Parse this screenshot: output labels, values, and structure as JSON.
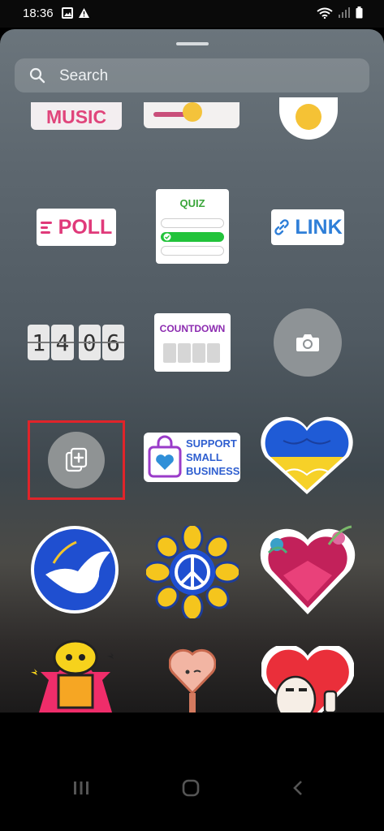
{
  "status_bar": {
    "time": "18:36"
  },
  "search": {
    "placeholder": "Search"
  },
  "stickers": {
    "music_label": "MUSIC",
    "poll_label": "POLL",
    "quiz_label": "QUIZ",
    "link_label": "LINK",
    "clock_digits": [
      "1",
      "4",
      "0",
      "6"
    ],
    "countdown_label": "COUNTDOWN",
    "support_text": [
      "SUPPORT",
      "SMALL",
      "BUSINESS"
    ]
  },
  "colors": {
    "highlight": "#e0242a",
    "poll": "#e03a7a",
    "quiz": "#3aa63a",
    "link": "#2f7fd8",
    "countdown": "#8c2bb0",
    "support": "#2f5fd0"
  },
  "icons": {
    "search": "search-icon",
    "camera": "camera-icon",
    "add_photo": "add-photo-icon",
    "recents": "recents-icon",
    "home": "home-icon",
    "back": "back-icon"
  }
}
